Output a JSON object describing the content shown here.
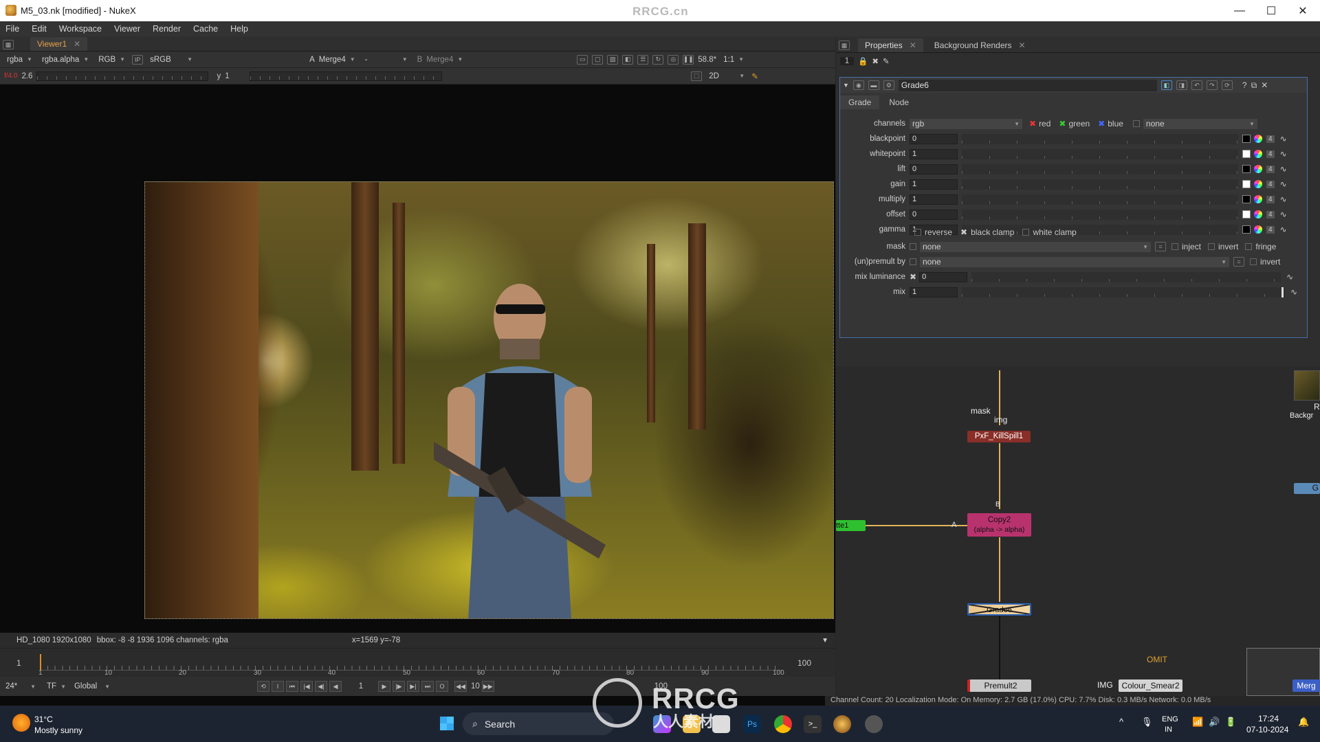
{
  "window": {
    "title": "M5_03.nk [modified] - NukeX",
    "watermark": "RRCG.cn",
    "controls": [
      "—",
      "☐",
      "✕"
    ]
  },
  "menu": [
    "File",
    "Edit",
    "Workspace",
    "Viewer",
    "Render",
    "Cache",
    "Help"
  ],
  "viewer": {
    "tab": "Viewer1",
    "channels": "rgba",
    "alpha": "rgba.alpha",
    "display": "RGB",
    "lut": "sRGB",
    "input_a_label": "A",
    "input_a": "Merge4",
    "compare": "-",
    "input_b_label": "B",
    "input_b": "Merge4",
    "fps": "58.8*",
    "zoom": "1:1",
    "fstop": "f/4.0",
    "gain": "2.6",
    "gamma_label": "y",
    "gamma": "1",
    "mode": "2D",
    "status_format": "HD_1080 1920x1080",
    "status_bbox": "bbox: -8 -8 1936 1096 channels: rgba",
    "cursor": "x=1569 y=-78",
    "timeline_start": "1",
    "timeline_end": "100",
    "timeline_ticks": [
      "1",
      "10",
      "20",
      "30",
      "40",
      "50",
      "60",
      "70",
      "80",
      "90",
      "100"
    ],
    "fps_setting": "24*",
    "tf": "TF",
    "scope": "Global",
    "current_frame": "1",
    "step": "10",
    "end_frame": "100"
  },
  "properties": {
    "tabs": [
      "Properties",
      "Background Renders"
    ],
    "panel_count": "1",
    "node_name": "Grade6",
    "subtabs": [
      "Grade",
      "Node"
    ],
    "channels": {
      "label": "channels",
      "value": "rgb",
      "red": "red",
      "green": "green",
      "blue": "blue",
      "extra": "none"
    },
    "params": [
      {
        "label": "blackpoint",
        "value": "0"
      },
      {
        "label": "whitepoint",
        "value": "1"
      },
      {
        "label": "lift",
        "value": "0"
      },
      {
        "label": "gain",
        "value": "1"
      },
      {
        "label": "multiply",
        "value": "1"
      },
      {
        "label": "offset",
        "value": "0"
      },
      {
        "label": "gamma",
        "value": "1"
      }
    ],
    "clamps": {
      "reverse": "reverse",
      "black_clamp": "black clamp",
      "white_clamp": "white clamp"
    },
    "mask": {
      "label": "mask",
      "value": "none",
      "inject": "inject",
      "invert": "invert",
      "fringe": "fringe"
    },
    "unpremult": {
      "label": "(un)premult by",
      "value": "none",
      "invert": "invert"
    },
    "mix_luminance": {
      "label": "mix luminance",
      "value": "0"
    },
    "mix": {
      "label": "mix",
      "value": "1"
    },
    "count_badge": "4"
  },
  "nodegraph": {
    "input_labels": {
      "mask": "mask",
      "img": "img",
      "a": "A",
      "b": "B"
    },
    "nodes": {
      "killspill": "PxF_KillSpill1",
      "copy": "Copy2",
      "copy_sub": "(alpha -> alpha)",
      "matte": "tte1",
      "crosswalk": "Grade6",
      "premult": "Premult2",
      "omit": "OMIT",
      "img_label": "IMG",
      "smear": "Colour_Smear2",
      "merge": "Merg",
      "side_r": "R",
      "side_bg": "Backgr",
      "side_g": "G"
    }
  },
  "app_status": "Channel Count: 20  Localization Mode: On  Memory: 2.7 GB (17.0%)  CPU: 7.7%  Disk: 0.3 MB/s  Network: 0.0 MB/s",
  "taskbar": {
    "weather_temp": "31°C",
    "weather_desc": "Mostly sunny",
    "search": "Search",
    "lang_top": "ENG",
    "lang_bottom": "IN",
    "time": "17:24",
    "date": "07-10-2024",
    "watermark": "RRCG",
    "watermark_cn": "人人素材"
  }
}
